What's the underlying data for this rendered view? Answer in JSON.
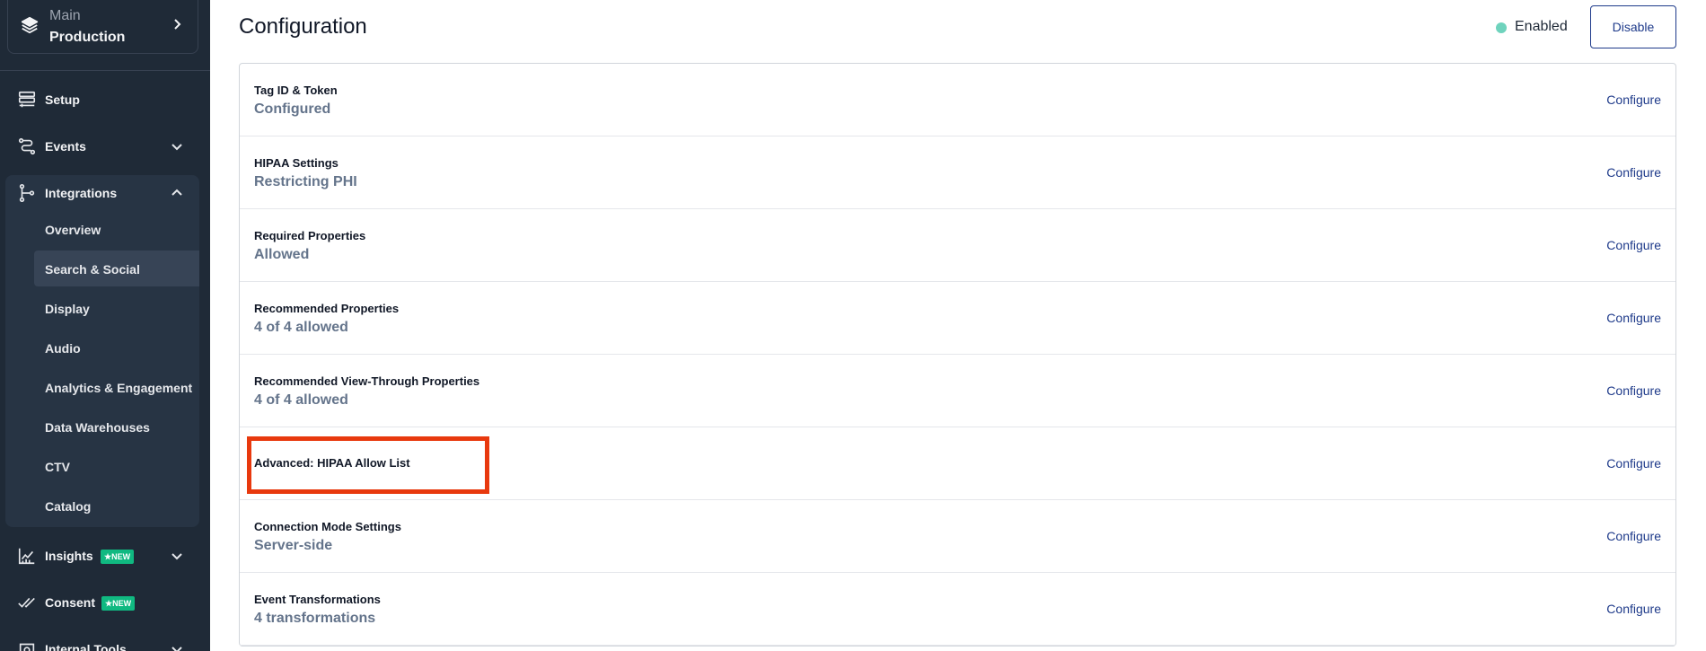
{
  "sidebar": {
    "env": {
      "top": "Main",
      "bottom": "Production"
    },
    "nav": [
      {
        "label": "Setup"
      },
      {
        "label": "Events"
      },
      {
        "label": "Integrations"
      },
      {
        "label": "Insights",
        "badge": "★NEW"
      },
      {
        "label": "Consent",
        "badge": "★NEW"
      },
      {
        "label": "Internal Tools"
      }
    ],
    "integrations_items": [
      {
        "label": "Overview"
      },
      {
        "label": "Search & Social"
      },
      {
        "label": "Display"
      },
      {
        "label": "Audio"
      },
      {
        "label": "Analytics & Engagement"
      },
      {
        "label": "Data Warehouses"
      },
      {
        "label": "CTV"
      },
      {
        "label": "Catalog"
      }
    ],
    "active_item": "Search & Social"
  },
  "main": {
    "title": "Configuration",
    "status": "Enabled",
    "disable_label": "Disable",
    "rows": [
      {
        "label": "Tag ID & Token",
        "value": "Configured",
        "action": "Configure"
      },
      {
        "label": "HIPAA Settings",
        "value": "Restricting PHI",
        "action": "Configure"
      },
      {
        "label": "Required Properties",
        "value": "Allowed",
        "action": "Configure"
      },
      {
        "label": "Recommended Properties",
        "value": "4 of 4 allowed",
        "action": "Configure"
      },
      {
        "label": "Recommended View-Through Properties",
        "value": "4 of 4 allowed",
        "action": "Configure"
      },
      {
        "label": "Advanced: HIPAA Allow List",
        "value": "",
        "action": "Configure"
      },
      {
        "label": "Connection Mode Settings",
        "value": "Server-side",
        "action": "Configure"
      },
      {
        "label": "Event Transformations",
        "value": "4 transformations",
        "action": "Configure"
      }
    ]
  },
  "colors": {
    "sidebar_bg": "#1f2a37",
    "status_dot": "#6fd3bd",
    "link": "#1e3a8a",
    "highlight": "#e8390e",
    "badge": "#10b981"
  }
}
